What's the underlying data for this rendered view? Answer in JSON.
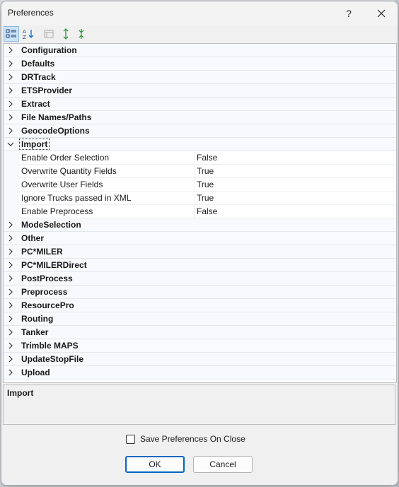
{
  "window": {
    "title": "Preferences",
    "help_label": "?"
  },
  "toolbar": {
    "categorized_icon": "categorized-view-icon",
    "alphabetical_icon": "alphabetical-sort-icon",
    "property_pages_icon": "property-pages-icon",
    "expand_all_icon": "expand-all-icon",
    "collapse_all_icon": "collapse-all-icon"
  },
  "grid": {
    "categories_before": [
      "Configuration",
      "Defaults",
      "DRTrack",
      "ETSProvider",
      "Extract",
      "File Names/Paths",
      "GeocodeOptions"
    ],
    "expanded": {
      "label": "Import",
      "properties": [
        {
          "name": "Enable Order Selection",
          "value": "False"
        },
        {
          "name": "Overwrite Quantity Fields",
          "value": "True"
        },
        {
          "name": "Overwrite User Fields",
          "value": "True"
        },
        {
          "name": "Ignore Trucks passed in XML",
          "value": "True"
        },
        {
          "name": "Enable Preprocess",
          "value": "False"
        }
      ]
    },
    "categories_after": [
      "ModeSelection",
      "Other",
      "PC*MILER",
      "PC*MILERDirect",
      "PostProcess",
      "Preprocess",
      "ResourcePro",
      "Routing",
      "Tanker",
      "Trimble MAPS",
      "UpdateStopFile",
      "Upload"
    ]
  },
  "description": {
    "title": "Import"
  },
  "options": {
    "save_on_close_label": "Save Preferences On Close",
    "save_on_close_checked": false
  },
  "buttons": {
    "ok_label": "OK",
    "cancel_label": "Cancel"
  },
  "colors": {
    "accent": "#0067c0",
    "category_bg": "#f7f9fc"
  }
}
